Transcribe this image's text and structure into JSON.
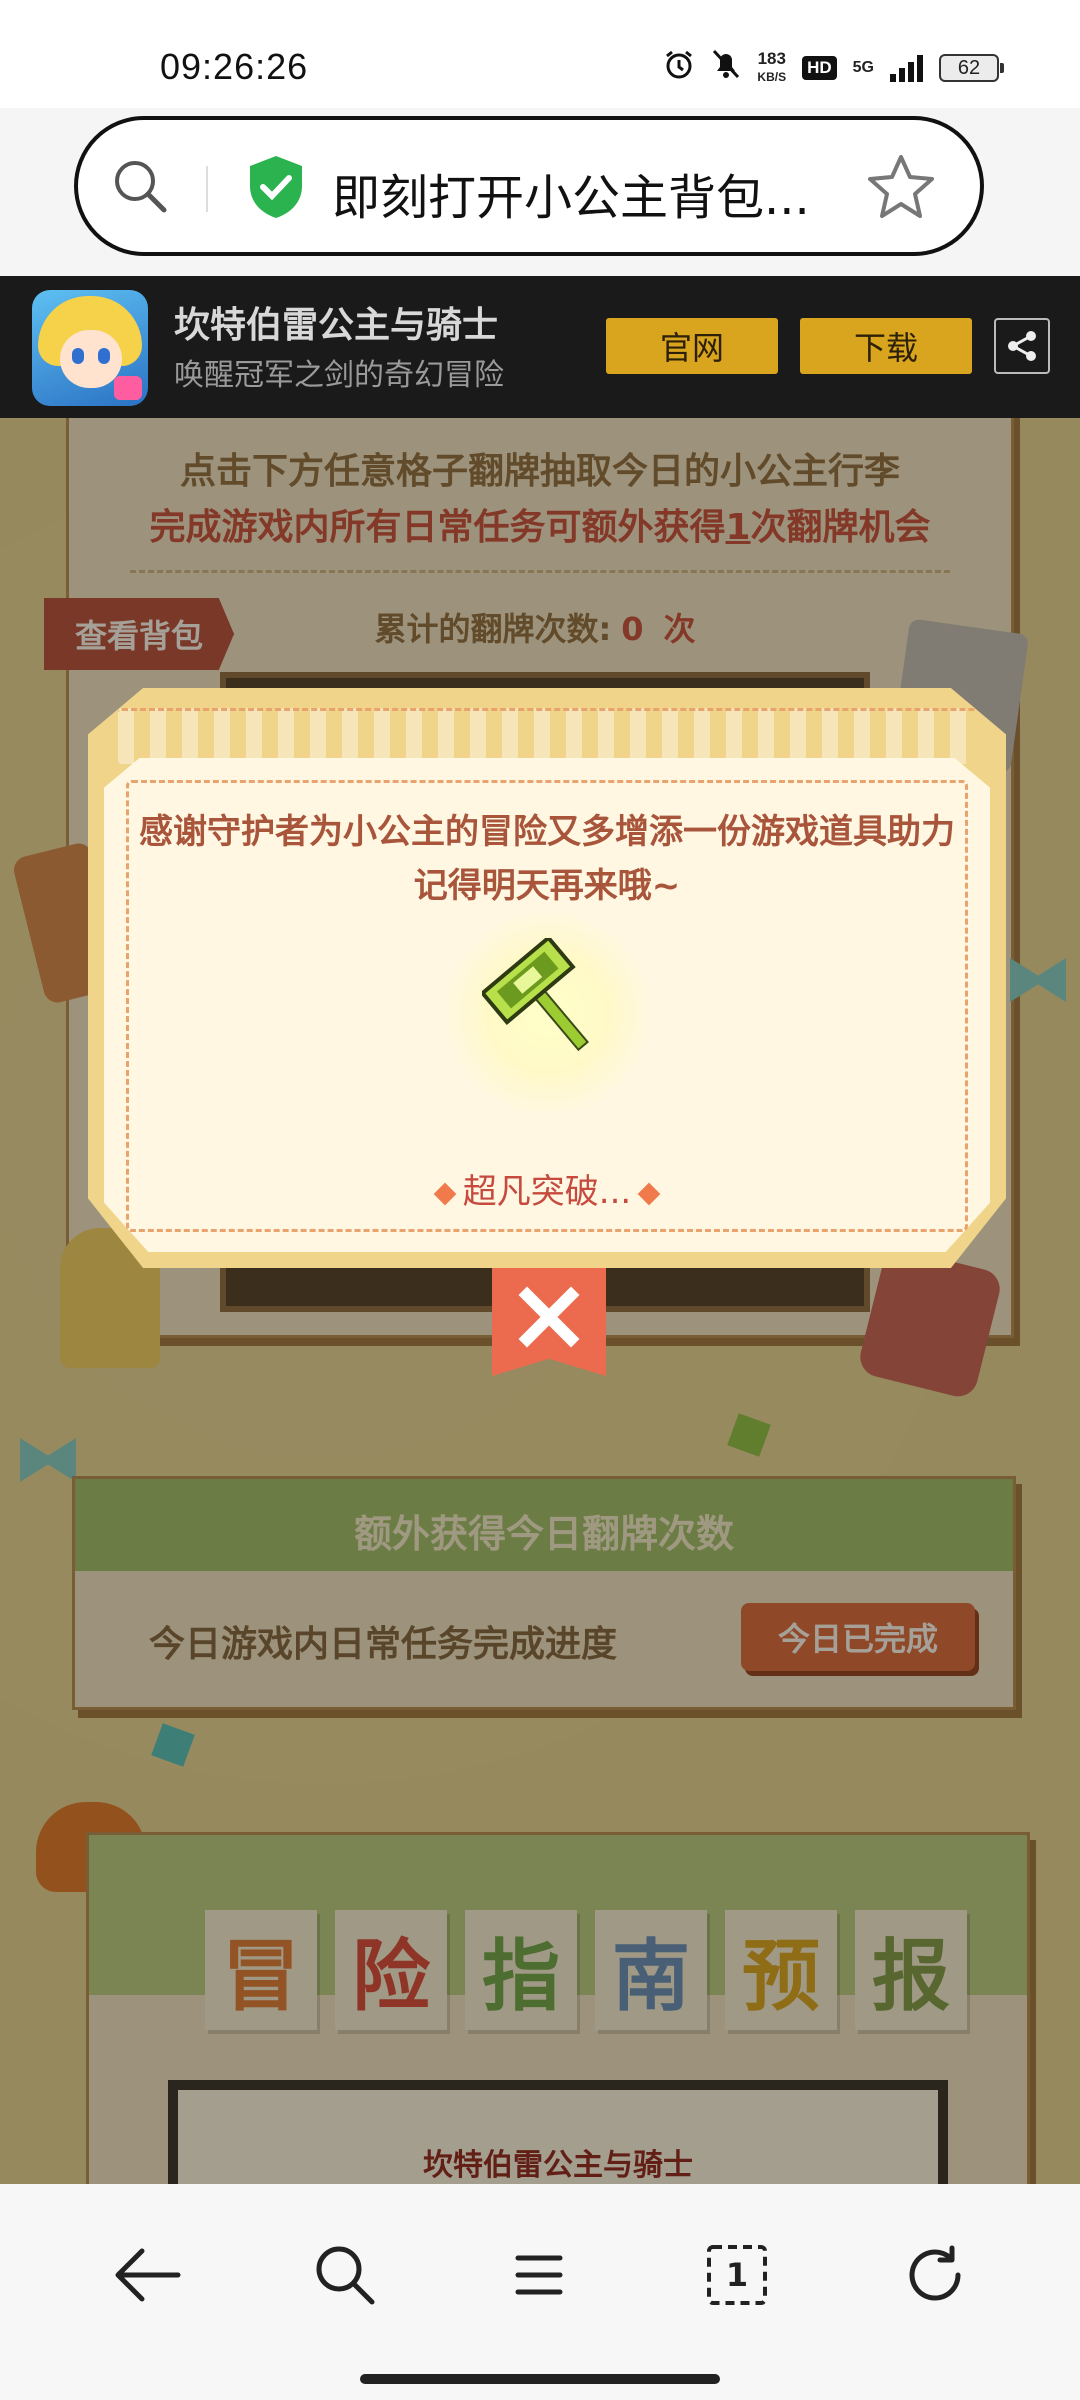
{
  "status_bar": {
    "time": "09:26:26",
    "net_speed_value": "183",
    "net_speed_unit": "KB/S",
    "hd_label": "HD",
    "network_label": "5G",
    "battery": "62",
    "icons": [
      "alarm-icon",
      "mute-bell-icon",
      "signal-icon",
      "battery-icon"
    ]
  },
  "address_bar": {
    "title": "即刻打开小公主背包...",
    "icons": [
      "search-icon",
      "shield-check-icon",
      "star-icon"
    ]
  },
  "game_banner": {
    "title": "坎特伯雷公主与骑士",
    "subtitle": "唤醒冠军之剑的奇幻冒险",
    "official_label": "官网",
    "download_label": "下载",
    "icons": [
      "app-icon",
      "share-icon"
    ]
  },
  "page": {
    "instruction_line1": "点击下方任意格子翻牌抽取今日的小公主行李",
    "instruction_line2_prefix": "完成游戏内所有日常任务可额外获得",
    "instruction_line2_num": "1",
    "instruction_line2_suffix": "次翻牌机会",
    "backpack_label": "查看背包",
    "count_prefix": "累计的翻牌次数:",
    "count_value": "0",
    "count_suffix": "次"
  },
  "modal": {
    "line1": "感谢守护者为小公主的冒险又多增添一份游戏道具助力",
    "line2": "记得明天再来哦~",
    "item_name": "超凡突破...",
    "icons": [
      "hammer-item-icon",
      "close-icon"
    ]
  },
  "extra_card": {
    "title": "额外获得今日翻牌次数",
    "progress_label": "今日游戏内日常任务完成进度",
    "status_label": "今日已完成"
  },
  "guide_card": {
    "tiles": [
      "冒",
      "险",
      "指",
      "南",
      "预",
      "报"
    ],
    "tile_colors": [
      "#e07a3a",
      "#d9453f",
      "#6aa84f",
      "#5f8ec4",
      "#d9a51f",
      "#7a9a4a"
    ],
    "logo_text": "坎特伯雷公主与骑士"
  },
  "bottom_nav": {
    "tab_count": "1",
    "icons": [
      "back-arrow-icon",
      "search-icon",
      "menu-icon",
      "tabs-icon",
      "refresh-icon"
    ]
  },
  "colors": {
    "brand_gold": "#d9a51f",
    "accent_red": "#c64a3e",
    "green_header": "#9cbf70"
  }
}
